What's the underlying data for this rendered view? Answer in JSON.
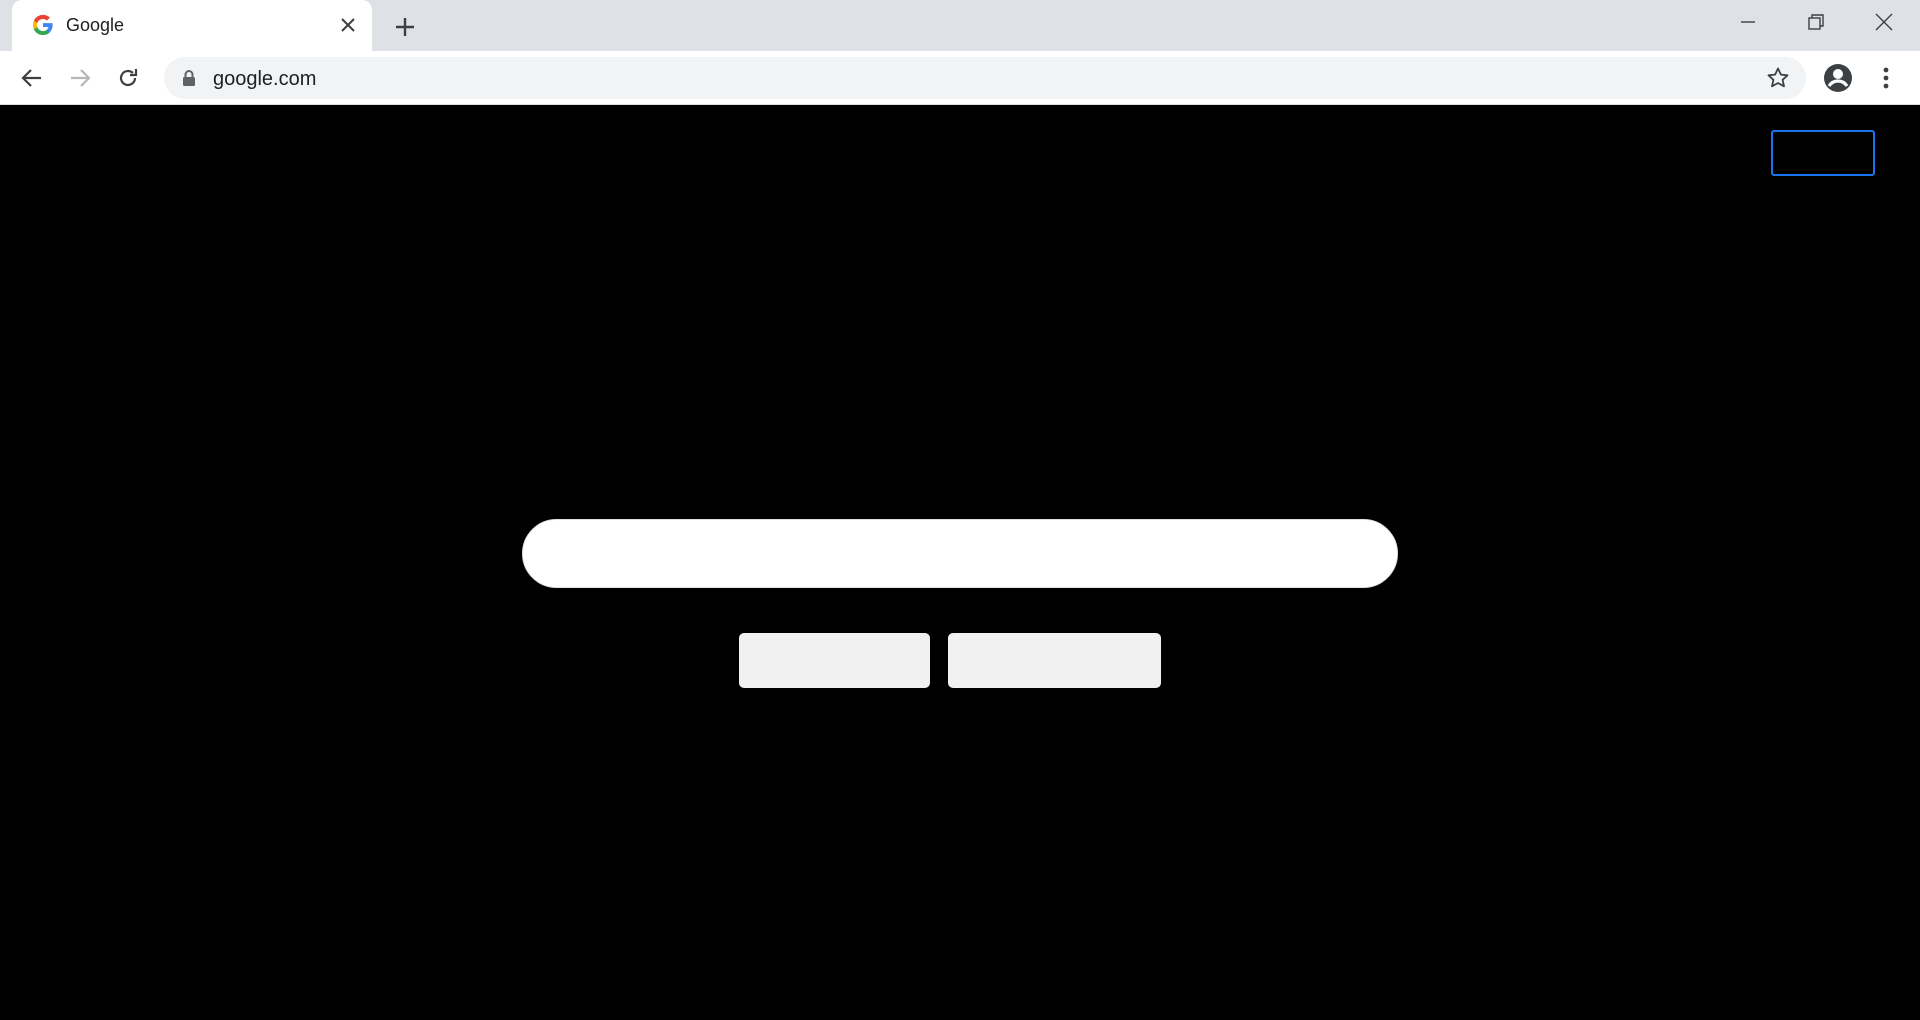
{
  "browser": {
    "tab": {
      "title": "Google",
      "favicon": "google-g-icon",
      "close_icon": "close-icon"
    },
    "new_tab_icon": "plus-icon",
    "window_controls": [
      "minimize-icon",
      "restore-icon",
      "close-icon"
    ],
    "nav": [
      "back-arrow-icon",
      "forward-arrow-icon",
      "reload-icon"
    ],
    "address_bar": {
      "url": "google.com",
      "lock_icon": "lock-icon",
      "bookmark_icon": "star-icon"
    },
    "profile_icon": "account-circle-icon",
    "menu_icon": "more-vert-icon"
  },
  "page": {
    "background": "#000000",
    "signin_button_label": "",
    "search": {
      "value": "",
      "placeholder": ""
    },
    "search_button_label": "",
    "lucky_button_label": ""
  },
  "colors": {
    "focus_outline": "#1a73e8",
    "tabstrip": "#dee1e6",
    "omnibox": "#f1f3f4"
  }
}
